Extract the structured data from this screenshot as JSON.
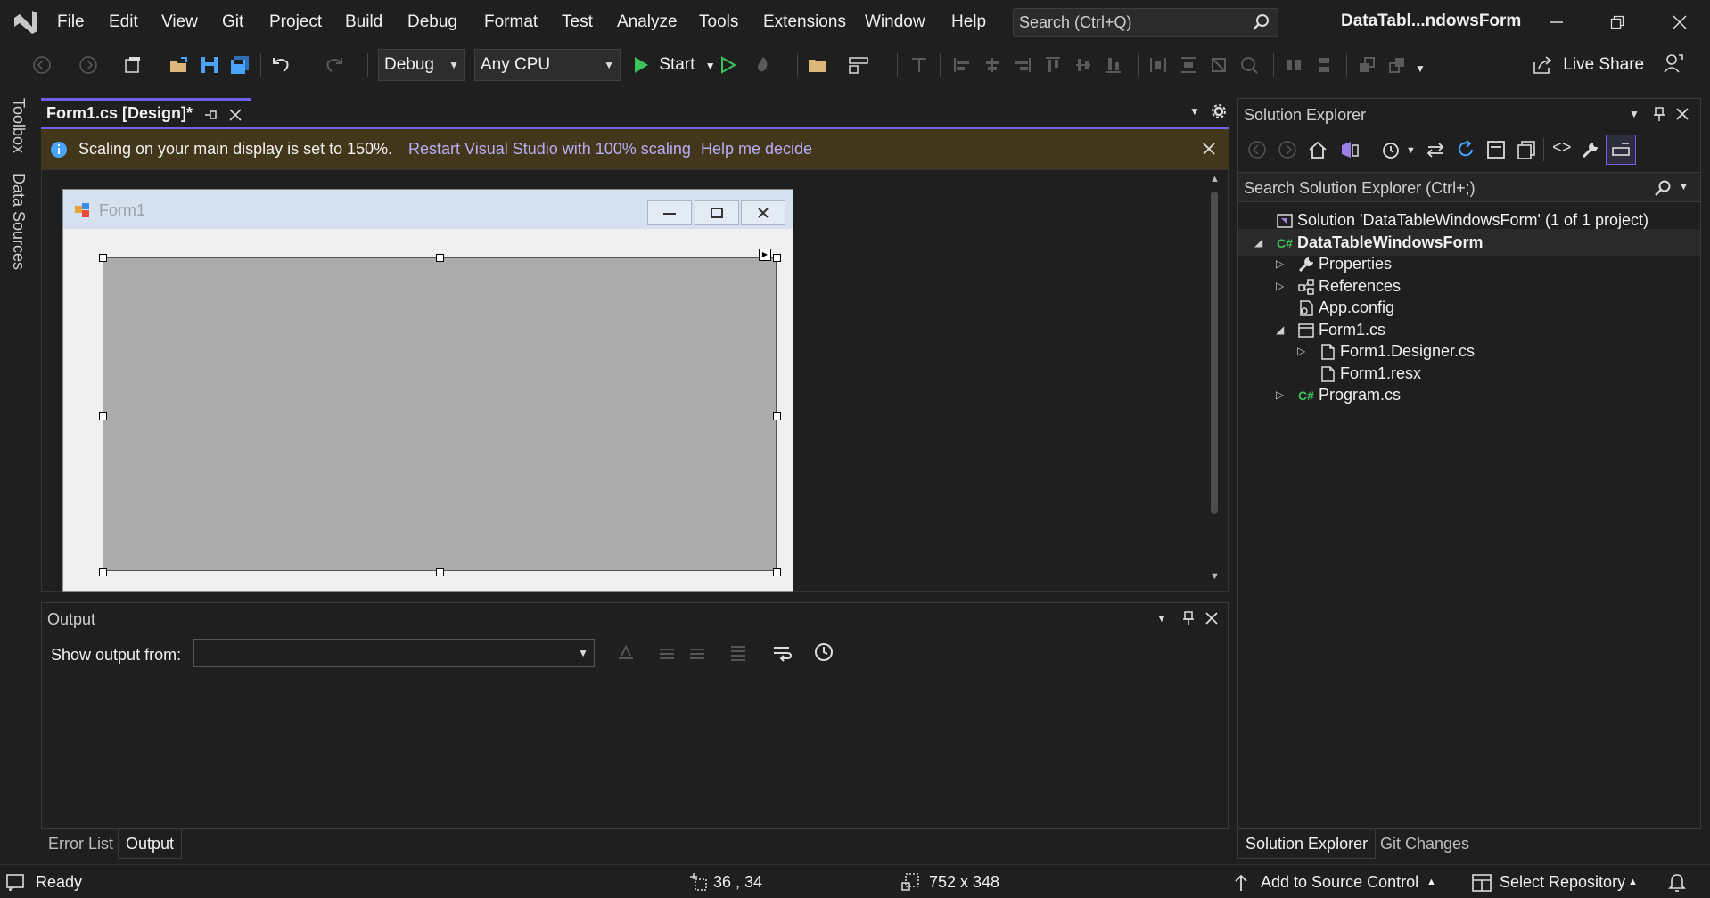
{
  "menubar": {
    "items": [
      "File",
      "Edit",
      "View",
      "Git",
      "Project",
      "Build",
      "Debug",
      "Format",
      "Test",
      "Analyze",
      "Tools",
      "Extensions",
      "Window",
      "Help"
    ],
    "search_placeholder": "Search (Ctrl+Q)",
    "solution_title": "DataTabl...ndowsForm"
  },
  "toolbar": {
    "config": "Debug",
    "platform": "Any CPU",
    "start_label": "Start",
    "live_share": "Live Share"
  },
  "left_tabs": [
    "Toolbox",
    "Data Sources"
  ],
  "editor": {
    "tab_label": "Form1.cs [Design]*",
    "info_message": "Scaling on your main display is set to 150%.",
    "info_link1": "Restart Visual Studio with 100% scaling",
    "info_link2": "Help me decide",
    "form_caption": "Form1"
  },
  "output": {
    "title": "Output",
    "show_from_label": "Show output from:",
    "source_value": ""
  },
  "bottom_tabs": [
    "Error List",
    "Output"
  ],
  "solution_explorer": {
    "title": "Solution Explorer",
    "search_placeholder": "Search Solution Explorer (Ctrl+;)",
    "tree": [
      {
        "label": "Solution 'DataTableWindowsForm' (1 of 1 project)",
        "expander": "",
        "icon": "solution-icon"
      },
      {
        "label": "DataTableWindowsForm",
        "expander": "◢",
        "icon": "csharp-project-icon"
      },
      {
        "label": "Properties",
        "expander": "▷",
        "icon": "wrench-icon"
      },
      {
        "label": "References",
        "expander": "▷",
        "icon": "references-icon"
      },
      {
        "label": "App.config",
        "expander": "",
        "icon": "config-file-icon"
      },
      {
        "label": "Form1.cs",
        "expander": "◢",
        "icon": "form-icon"
      },
      {
        "label": "Form1.Designer.cs",
        "expander": "▷",
        "icon": "file-icon"
      },
      {
        "label": "Form1.resx",
        "expander": "",
        "icon": "file-icon"
      },
      {
        "label": "Program.cs",
        "expander": "▷",
        "icon": "csharp-file-icon"
      }
    ],
    "tabs": [
      "Solution Explorer",
      "Git Changes"
    ]
  },
  "statusbar": {
    "ready": "Ready",
    "position": "36 , 34",
    "size": "752 x 348",
    "source_control": "Add to Source Control",
    "repository": "Select Repository"
  },
  "colors": {
    "accent": "#7160e8",
    "info_bar": "#42371a",
    "link": "#b8adf5",
    "start_green": "#3cc25a"
  }
}
